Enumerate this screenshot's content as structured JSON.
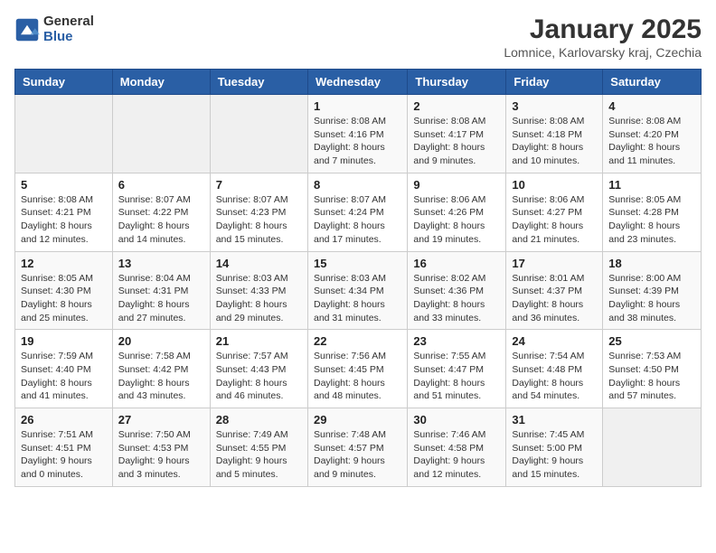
{
  "header": {
    "logo_general": "General",
    "logo_blue": "Blue",
    "title": "January 2025",
    "location": "Lomnice, Karlovarsky kraj, Czechia"
  },
  "days_of_week": [
    "Sunday",
    "Monday",
    "Tuesday",
    "Wednesday",
    "Thursday",
    "Friday",
    "Saturday"
  ],
  "weeks": [
    [
      {
        "day": "",
        "info": ""
      },
      {
        "day": "",
        "info": ""
      },
      {
        "day": "",
        "info": ""
      },
      {
        "day": "1",
        "info": "Sunrise: 8:08 AM\nSunset: 4:16 PM\nDaylight: 8 hours\nand 7 minutes."
      },
      {
        "day": "2",
        "info": "Sunrise: 8:08 AM\nSunset: 4:17 PM\nDaylight: 8 hours\nand 9 minutes."
      },
      {
        "day": "3",
        "info": "Sunrise: 8:08 AM\nSunset: 4:18 PM\nDaylight: 8 hours\nand 10 minutes."
      },
      {
        "day": "4",
        "info": "Sunrise: 8:08 AM\nSunset: 4:20 PM\nDaylight: 8 hours\nand 11 minutes."
      }
    ],
    [
      {
        "day": "5",
        "info": "Sunrise: 8:08 AM\nSunset: 4:21 PM\nDaylight: 8 hours\nand 12 minutes."
      },
      {
        "day": "6",
        "info": "Sunrise: 8:07 AM\nSunset: 4:22 PM\nDaylight: 8 hours\nand 14 minutes."
      },
      {
        "day": "7",
        "info": "Sunrise: 8:07 AM\nSunset: 4:23 PM\nDaylight: 8 hours\nand 15 minutes."
      },
      {
        "day": "8",
        "info": "Sunrise: 8:07 AM\nSunset: 4:24 PM\nDaylight: 8 hours\nand 17 minutes."
      },
      {
        "day": "9",
        "info": "Sunrise: 8:06 AM\nSunset: 4:26 PM\nDaylight: 8 hours\nand 19 minutes."
      },
      {
        "day": "10",
        "info": "Sunrise: 8:06 AM\nSunset: 4:27 PM\nDaylight: 8 hours\nand 21 minutes."
      },
      {
        "day": "11",
        "info": "Sunrise: 8:05 AM\nSunset: 4:28 PM\nDaylight: 8 hours\nand 23 minutes."
      }
    ],
    [
      {
        "day": "12",
        "info": "Sunrise: 8:05 AM\nSunset: 4:30 PM\nDaylight: 8 hours\nand 25 minutes."
      },
      {
        "day": "13",
        "info": "Sunrise: 8:04 AM\nSunset: 4:31 PM\nDaylight: 8 hours\nand 27 minutes."
      },
      {
        "day": "14",
        "info": "Sunrise: 8:03 AM\nSunset: 4:33 PM\nDaylight: 8 hours\nand 29 minutes."
      },
      {
        "day": "15",
        "info": "Sunrise: 8:03 AM\nSunset: 4:34 PM\nDaylight: 8 hours\nand 31 minutes."
      },
      {
        "day": "16",
        "info": "Sunrise: 8:02 AM\nSunset: 4:36 PM\nDaylight: 8 hours\nand 33 minutes."
      },
      {
        "day": "17",
        "info": "Sunrise: 8:01 AM\nSunset: 4:37 PM\nDaylight: 8 hours\nand 36 minutes."
      },
      {
        "day": "18",
        "info": "Sunrise: 8:00 AM\nSunset: 4:39 PM\nDaylight: 8 hours\nand 38 minutes."
      }
    ],
    [
      {
        "day": "19",
        "info": "Sunrise: 7:59 AM\nSunset: 4:40 PM\nDaylight: 8 hours\nand 41 minutes."
      },
      {
        "day": "20",
        "info": "Sunrise: 7:58 AM\nSunset: 4:42 PM\nDaylight: 8 hours\nand 43 minutes."
      },
      {
        "day": "21",
        "info": "Sunrise: 7:57 AM\nSunset: 4:43 PM\nDaylight: 8 hours\nand 46 minutes."
      },
      {
        "day": "22",
        "info": "Sunrise: 7:56 AM\nSunset: 4:45 PM\nDaylight: 8 hours\nand 48 minutes."
      },
      {
        "day": "23",
        "info": "Sunrise: 7:55 AM\nSunset: 4:47 PM\nDaylight: 8 hours\nand 51 minutes."
      },
      {
        "day": "24",
        "info": "Sunrise: 7:54 AM\nSunset: 4:48 PM\nDaylight: 8 hours\nand 54 minutes."
      },
      {
        "day": "25",
        "info": "Sunrise: 7:53 AM\nSunset: 4:50 PM\nDaylight: 8 hours\nand 57 minutes."
      }
    ],
    [
      {
        "day": "26",
        "info": "Sunrise: 7:51 AM\nSunset: 4:51 PM\nDaylight: 9 hours\nand 0 minutes."
      },
      {
        "day": "27",
        "info": "Sunrise: 7:50 AM\nSunset: 4:53 PM\nDaylight: 9 hours\nand 3 minutes."
      },
      {
        "day": "28",
        "info": "Sunrise: 7:49 AM\nSunset: 4:55 PM\nDaylight: 9 hours\nand 5 minutes."
      },
      {
        "day": "29",
        "info": "Sunrise: 7:48 AM\nSunset: 4:57 PM\nDaylight: 9 hours\nand 9 minutes."
      },
      {
        "day": "30",
        "info": "Sunrise: 7:46 AM\nSunset: 4:58 PM\nDaylight: 9 hours\nand 12 minutes."
      },
      {
        "day": "31",
        "info": "Sunrise: 7:45 AM\nSunset: 5:00 PM\nDaylight: 9 hours\nand 15 minutes."
      },
      {
        "day": "",
        "info": ""
      }
    ]
  ]
}
